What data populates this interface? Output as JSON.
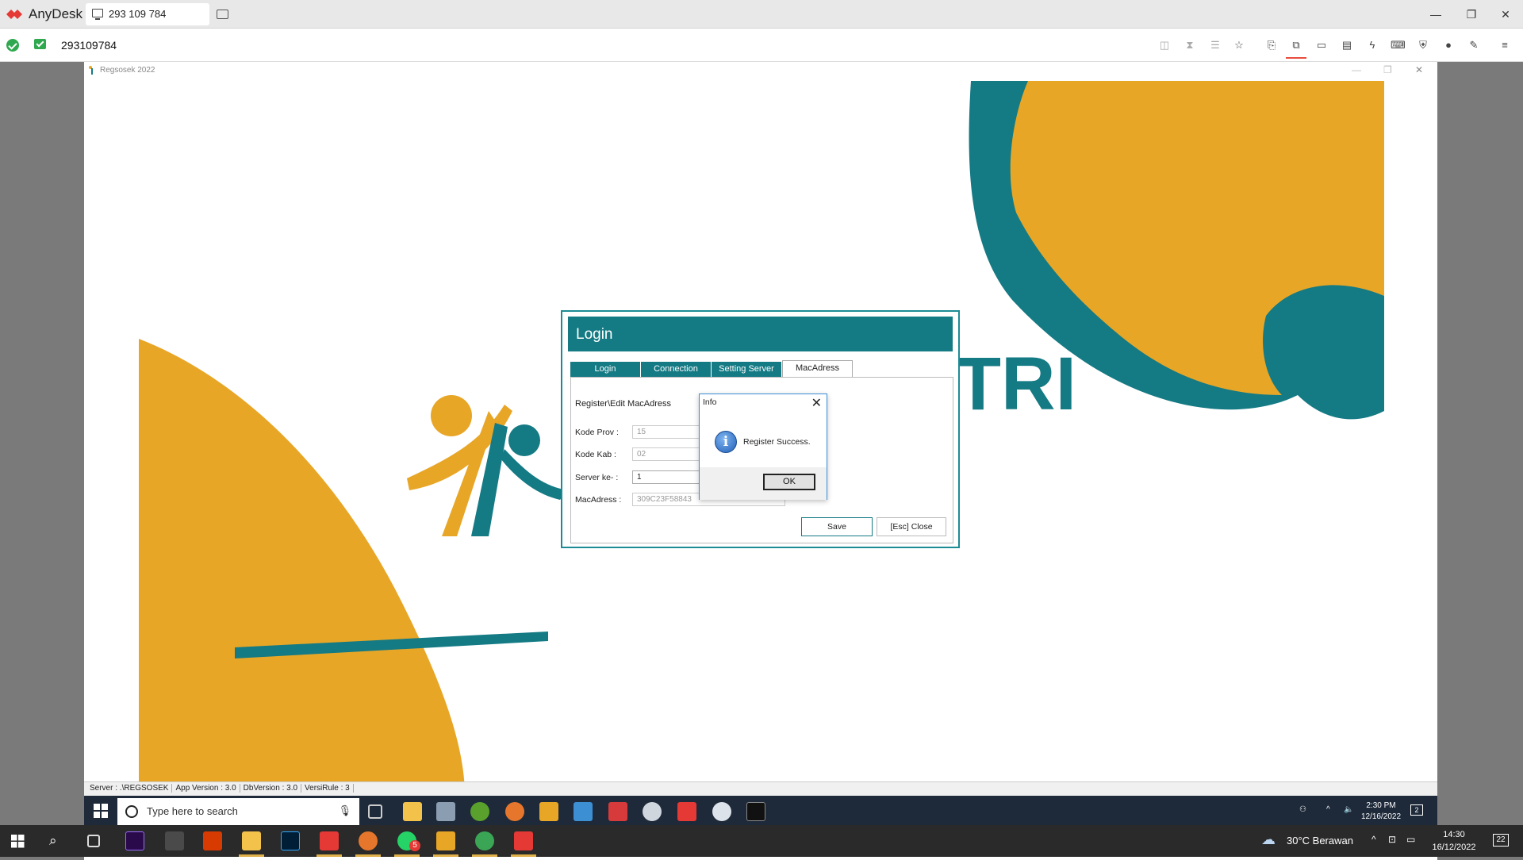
{
  "anydesk": {
    "app_name": "AnyDesk",
    "tab_label": "293 109 784",
    "address": "293109784"
  },
  "remote_window": {
    "title": "Regsosek 2022",
    "logo_text": "TRI"
  },
  "status_bar": {
    "server": "Server : .\\REGSOSEK",
    "app_version": "App Version : 3.0",
    "db_version": "DbVersion : 3.0",
    "versi_rule": "VersiRule : 3"
  },
  "login_dialog": {
    "title": "Login",
    "tabs": [
      "Login",
      "Connection",
      "Setting Server",
      "MacAdress"
    ],
    "active_tab": "MacAdress",
    "panel_title": "Register\\Edit MacAdress",
    "fields": [
      {
        "label": "Kode Prov :",
        "value": "15"
      },
      {
        "label": "Kode Kab :",
        "value": "02"
      },
      {
        "label": "Server ke- :",
        "value": "1"
      },
      {
        "label": "MacAdress :",
        "value": "309C23F58843"
      }
    ],
    "save_label": "Save",
    "close_label": "[Esc] Close"
  },
  "info_dialog": {
    "title": "Info",
    "message": "Register Success.",
    "ok_label": "OK"
  },
  "remote_taskbar": {
    "search_placeholder": "Type here to search",
    "time": "2:30 PM",
    "date": "12/16/2022",
    "notification_count": "2"
  },
  "local_taskbar": {
    "weather": "30°C  Berawan",
    "time": "14:30",
    "date": "16/12/2022",
    "notification_count": "22",
    "whatsapp_badge": "5"
  },
  "colors": {
    "teal": "#147a84",
    "gold": "#e8a627",
    "anydesk_red": "#e53935"
  }
}
